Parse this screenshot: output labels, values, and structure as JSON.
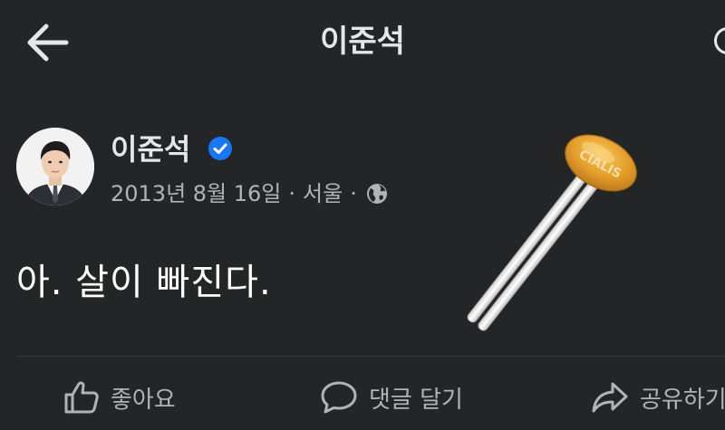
{
  "header": {
    "title": "이준석",
    "back_icon": "arrow-left-icon"
  },
  "post": {
    "author": "이준석",
    "verified": true,
    "date": "2013년 8월 16일",
    "location": "서울",
    "separator": "·",
    "audience_icon": "globe-icon",
    "text": "아. 살이 빠진다.",
    "image": {
      "pill_label": "CIALIS"
    }
  },
  "actions": {
    "like_label": "좋아요",
    "comment_label": "댓글 달기",
    "share_label": "공유하기"
  },
  "colors": {
    "background": "#242526",
    "text_primary": "#e4e6eb",
    "text_secondary": "#b0b3b8",
    "verified_blue": "#1877f2",
    "pill_orange": "#e09a2a"
  }
}
